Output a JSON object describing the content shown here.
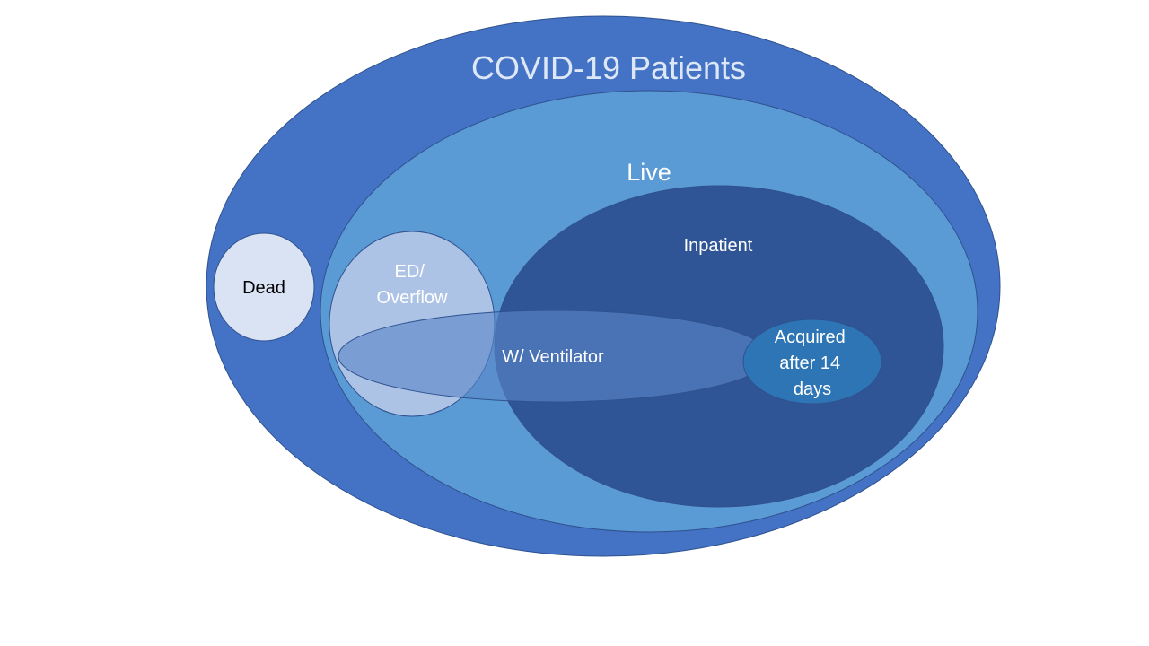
{
  "diagram": {
    "title": "COVID-19 Patients",
    "regions": {
      "live": "Live",
      "dead": "Dead",
      "ed_overflow": [
        "ED/",
        "Overflow"
      ],
      "inpatient": "Inpatient",
      "ventilator": "W/ Ventilator",
      "acquired": [
        "Acquired",
        "after 14",
        "days"
      ]
    },
    "colors": {
      "outer": "#4472c4",
      "live": "#5b9bd5",
      "inpatient": "#2f5597",
      "dead": "#dae3f3",
      "ed_overflow": "#b4c7e7",
      "ventilator": "#5b86c6",
      "acquired": "#2e75b6",
      "stroke": "#2f528f"
    }
  }
}
